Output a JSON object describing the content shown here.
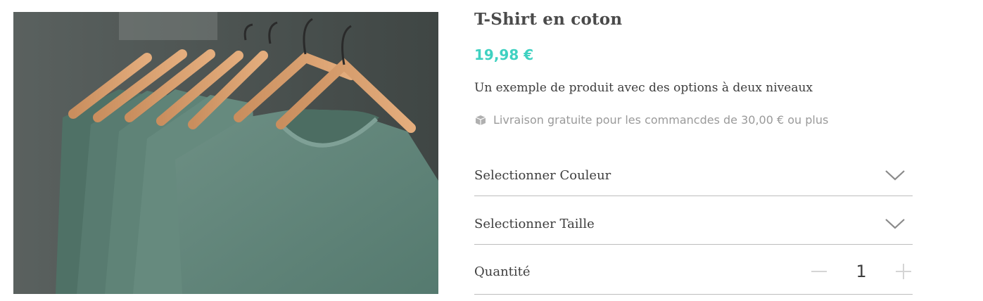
{
  "product": {
    "title": "T-Shirt en coton",
    "price": "19,98 €",
    "description": "Un exemple de produit avec des options à deux niveaux",
    "shipping_note": "Livraison gratuite pour les commancdes de 30,00 € ou plus",
    "image_icon": "tshirts-on-hangers-photo"
  },
  "options": {
    "color_label": "Selectionner Couleur",
    "size_label": "Selectionner Taille"
  },
  "quantity": {
    "label": "Quantité",
    "value": "1"
  },
  "colors": {
    "price": "#3fd1c1",
    "divider": "#bdbdbd",
    "muted": "#9a9a9a"
  }
}
